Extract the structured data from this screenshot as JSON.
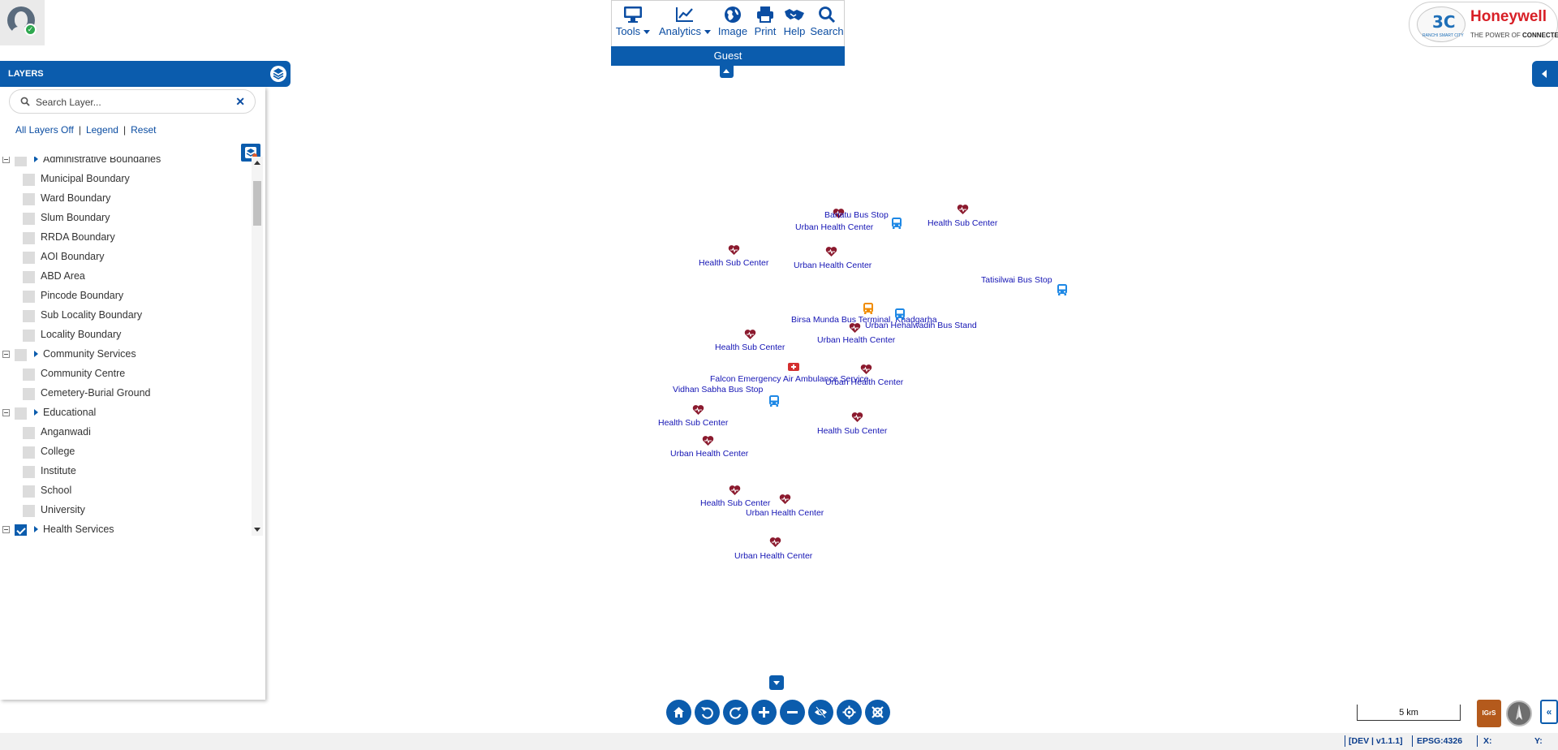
{
  "toolbar": {
    "items": [
      {
        "label": "Tools",
        "icon": "monitor-icon",
        "dropdown": true
      },
      {
        "label": "Analytics",
        "icon": "chart-line-icon",
        "dropdown": true
      },
      {
        "label": "Image",
        "icon": "globe-icon"
      },
      {
        "label": "Print",
        "icon": "print-icon"
      },
      {
        "label": "Help",
        "icon": "handshake-icon"
      },
      {
        "label": "Search",
        "icon": "search-icon"
      }
    ],
    "user_label": "Guest"
  },
  "logo": {
    "brand": "Honeywell",
    "tagline_prefix": "THE POWER OF ",
    "tagline_bold": "CONNECTED",
    "city_subtitle": "RANCHI SMART CITY"
  },
  "layers": {
    "title": "LAYERS",
    "search_placeholder": "Search Layer...",
    "clear_symbol": "✕",
    "links": {
      "all_off": "All Layers Off",
      "legend": "Legend",
      "reset": "Reset"
    },
    "tree": [
      {
        "type": "group",
        "label": "Administrative Boundaries",
        "checked": false
      },
      {
        "type": "item",
        "label": "Municipal Boundary"
      },
      {
        "type": "item",
        "label": "Ward Boundary"
      },
      {
        "type": "item",
        "label": "Slum Boundary"
      },
      {
        "type": "item",
        "label": "RRDA Boundary"
      },
      {
        "type": "item",
        "label": "AOI Boundary"
      },
      {
        "type": "item",
        "label": "ABD Area"
      },
      {
        "type": "item",
        "label": "Pincode Boundary"
      },
      {
        "type": "item",
        "label": "Sub Locality Boundary"
      },
      {
        "type": "item",
        "label": "Locality Boundary"
      },
      {
        "type": "group",
        "label": "Community Services",
        "checked": false
      },
      {
        "type": "item",
        "label": "Community Centre"
      },
      {
        "type": "item",
        "label": "Cemetery-Burial Ground"
      },
      {
        "type": "group",
        "label": "Educational",
        "checked": false
      },
      {
        "type": "item",
        "label": "Anganwadi"
      },
      {
        "type": "item",
        "label": "College"
      },
      {
        "type": "item",
        "label": "Institute"
      },
      {
        "type": "item",
        "label": "School"
      },
      {
        "type": "item",
        "label": "University"
      },
      {
        "type": "group",
        "label": "Health Services",
        "checked": true
      }
    ]
  },
  "map": {
    "pois": [
      {
        "kind": "health",
        "label": "Bariatu Bus Stop"
      },
      {
        "kind": "bus",
        "label": "Urban Health Center"
      },
      {
        "kind": "health",
        "label": "Health Sub Center"
      },
      {
        "kind": "health",
        "label": "Health Sub Center"
      },
      {
        "kind": "health",
        "label": "Urban Health Center"
      },
      {
        "kind": "bus",
        "label": "Tatisilwai Bus Stop"
      },
      {
        "kind": "bus-orange",
        "label": "Birsa Munda Bus Terminal, Khadgarha"
      },
      {
        "kind": "bus",
        "label": "Urban Hehalwadih Bus Stand"
      },
      {
        "kind": "health",
        "label": "Health Sub Center"
      },
      {
        "kind": "health",
        "label": "Urban Health Center"
      },
      {
        "kind": "ambulance",
        "label": "Falcon Emergency Air Ambulance Service"
      },
      {
        "kind": "health",
        "label": "Urban Health Center"
      },
      {
        "kind": "bus",
        "label": "Vidhan Sabha Bus Stop"
      },
      {
        "kind": "health",
        "label": "Health Sub Center"
      },
      {
        "kind": "health",
        "label": "Health Sub Center"
      },
      {
        "kind": "health",
        "label": "Urban Health Center"
      },
      {
        "kind": "health",
        "label": "Health Sub Center"
      },
      {
        "kind": "health",
        "label": "Urban Health Center"
      },
      {
        "kind": "health",
        "label": "Urban Health Center"
      }
    ]
  },
  "scale": {
    "label": "5 km"
  },
  "igrs_label": "IGrS",
  "expand_symbol": "«",
  "status": {
    "version": "[DEV | v1.1.1]",
    "epsg": "EPSG:4326",
    "x_label": "X:",
    "y_label": "Y:"
  },
  "colors": {
    "primary": "#0b5cad",
    "health": "#8b1a2e",
    "bus": "#1e88e5",
    "bus_orange": "#f08c00",
    "ambulance": "#d32f2f",
    "poi_label": "#1414b4"
  }
}
